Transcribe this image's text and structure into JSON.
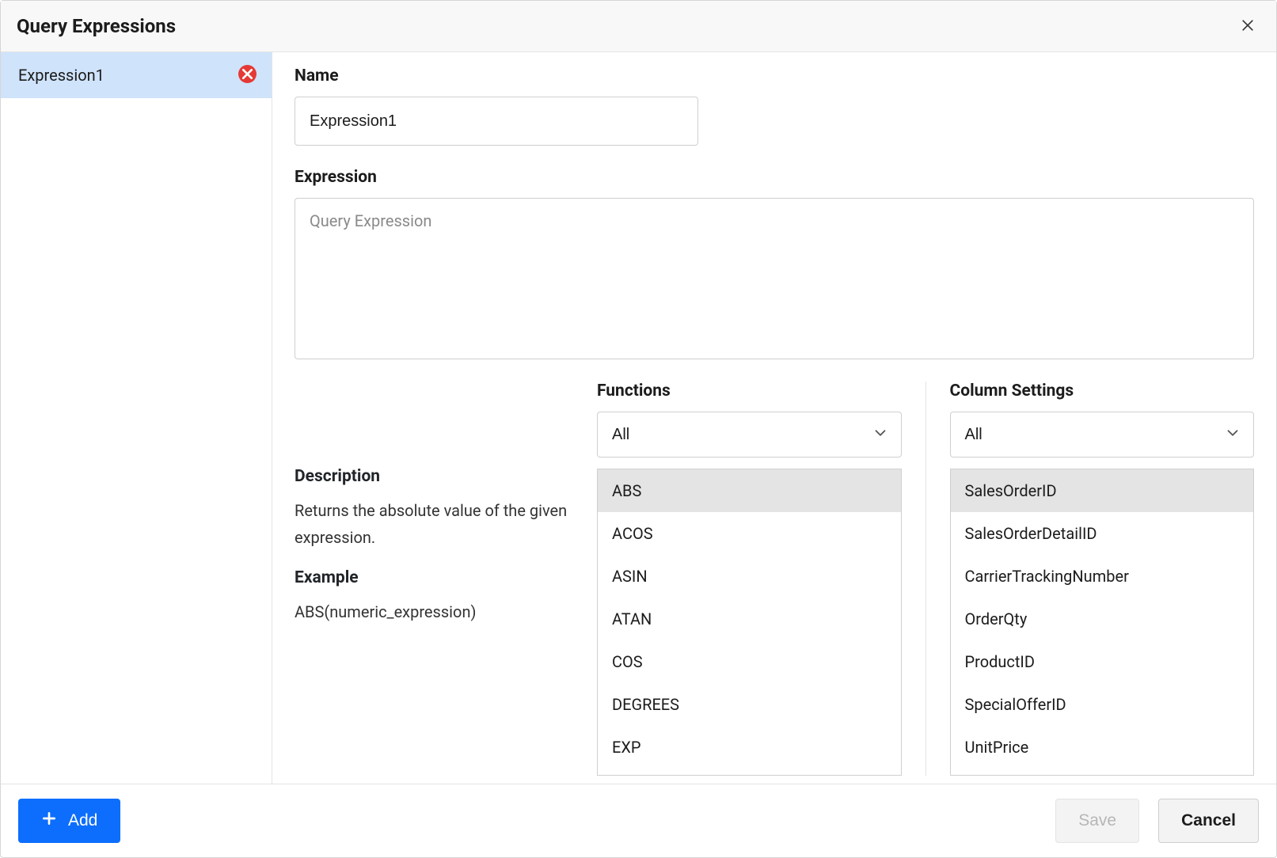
{
  "dialog": {
    "title": "Query Expressions"
  },
  "sidebar": {
    "items": [
      {
        "label": "Expression1"
      }
    ]
  },
  "form": {
    "name_label": "Name",
    "name_value": "Expression1",
    "expression_label": "Expression",
    "expression_placeholder": "Query Expression",
    "expression_value": ""
  },
  "description": {
    "heading": "Description",
    "text": "Returns the absolute value of the given expression.",
    "example_heading": "Example",
    "example_text": "ABS(numeric_expression)"
  },
  "functions": {
    "heading": "Functions",
    "filter_value": "All",
    "items": [
      "ABS",
      "ACOS",
      "ASIN",
      "ATAN",
      "COS",
      "DEGREES",
      "EXP"
    ],
    "selected": "ABS"
  },
  "columns": {
    "heading": "Column Settings",
    "filter_value": "All",
    "items": [
      "SalesOrderID",
      "SalesOrderDetailID",
      "CarrierTrackingNumber",
      "OrderQty",
      "ProductID",
      "SpecialOfferID",
      "UnitPrice"
    ],
    "selected": "SalesOrderID"
  },
  "footer": {
    "add_label": "Add",
    "save_label": "Save",
    "cancel_label": "Cancel"
  }
}
